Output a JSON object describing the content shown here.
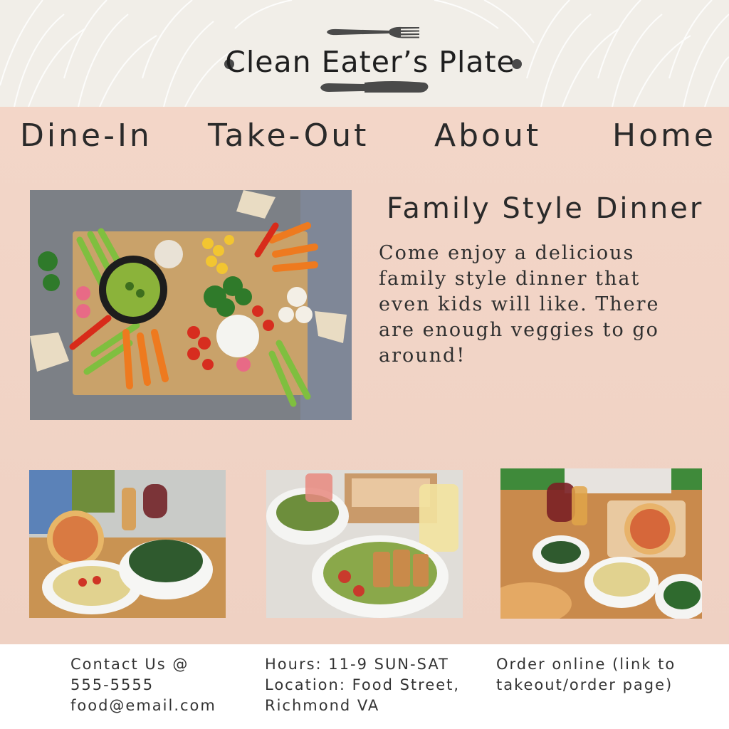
{
  "brand": {
    "title": "Clean Eater’s Plate",
    "colors": {
      "header_bg": "#f1eee8",
      "main_bg": "#f3d6c8",
      "text": "#2a2a2a",
      "utensil": "#4a4a4a"
    }
  },
  "nav": {
    "items": [
      {
        "label": "Dine-In"
      },
      {
        "label": "Take-Out"
      },
      {
        "label": "About"
      },
      {
        "label": "Home"
      }
    ]
  },
  "feature": {
    "title": "Family Style Dinner",
    "body": "Come enjoy a delicious family style dinner that even kids will like. There are enough veggies to go around!"
  },
  "icons": {
    "fork": "fork-icon",
    "knife": "knife-icon"
  },
  "footer": {
    "contact": {
      "line1": "Contact Us @",
      "phone": "555-5555",
      "email": "food@email.com"
    },
    "info": {
      "hours": "Hours: 11-9 SUN-SAT",
      "location_line1": "Location: Food Street,",
      "location_line2": "Richmond VA"
    },
    "order": {
      "line1": "Order online (link to",
      "line2": "takeout/order page)"
    }
  }
}
